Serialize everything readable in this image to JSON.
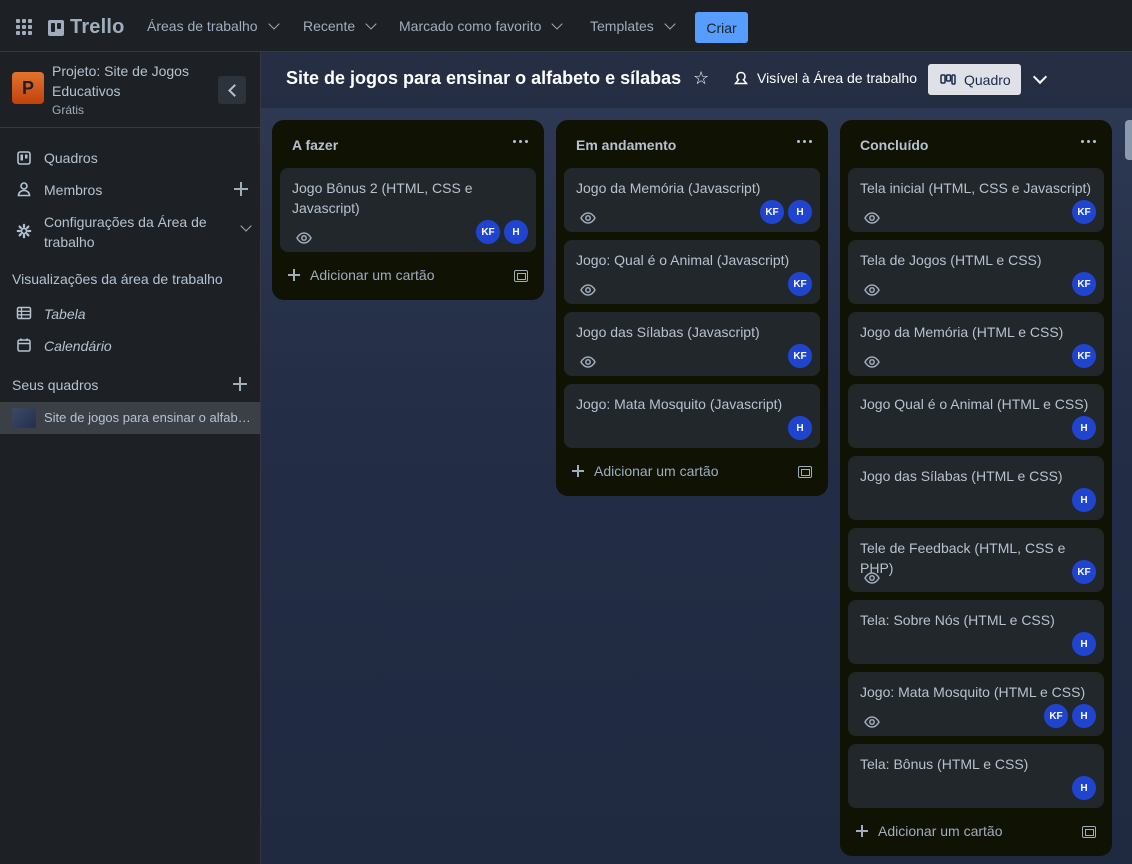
{
  "nav": {
    "logo": "Trello",
    "menus": [
      "Áreas de trabalho",
      "Recente",
      "Marcado como favorito",
      "Templates"
    ],
    "create_label": "Criar"
  },
  "sidebar": {
    "workspace_name": "Projeto:  Site de Jogos Educativos",
    "workspace_initial": "P",
    "workspace_plan": "Grátis",
    "items": [
      {
        "label": "Quadros",
        "icon": "board-icon"
      },
      {
        "label": "Membros",
        "icon": "member-icon"
      },
      {
        "label": "Configurações da Área de trabalho",
        "icon": "gear-icon"
      }
    ],
    "views_heading": "Visualizações da área de trabalho",
    "views": [
      {
        "label": "Tabela",
        "icon": "table-icon"
      },
      {
        "label": "Calendário",
        "icon": "calendar-icon"
      }
    ],
    "boards_heading": "Seus quadros",
    "boards": [
      "Site de jogos para ensinar o alfabeto e sílabas"
    ]
  },
  "board": {
    "title": "Site de jogos para ensinar o alfabeto e sílabas",
    "visibility": "Visível à Área de trabalho",
    "view_label": "Quadro",
    "add_card_label": "Adicionar um cartão",
    "lists": [
      {
        "title": "A fazer",
        "cards": [
          {
            "text": "Jogo Bônus 2 (HTML, CSS e Javascript)",
            "watch": true,
            "members": [
              "KF",
              "H"
            ]
          }
        ]
      },
      {
        "title": "Em andamento",
        "cards": [
          {
            "text": "Jogo da Memória (Javascript)",
            "watch": true,
            "members": [
              "KF",
              "H"
            ]
          },
          {
            "text": "Jogo: Qual é o Animal (Javascript)",
            "watch": true,
            "members": [
              "KF"
            ]
          },
          {
            "text": "Jogo das Sílabas (Javascript)",
            "watch": true,
            "members": [
              "KF"
            ]
          },
          {
            "text": "Jogo: Mata Mosquito (Javascript)",
            "watch": false,
            "members": [
              "H"
            ]
          }
        ]
      },
      {
        "title": "Concluído",
        "cards": [
          {
            "text": "Tela inicial (HTML, CSS e Javascript)",
            "watch": true,
            "members": [
              "KF"
            ]
          },
          {
            "text": "Tela de Jogos (HTML e CSS)",
            "watch": true,
            "members": [
              "KF"
            ]
          },
          {
            "text": "Jogo da Memória (HTML e CSS)",
            "watch": true,
            "members": [
              "KF"
            ]
          },
          {
            "text": "Jogo Qual é o Animal (HTML e CSS)",
            "watch": false,
            "members": [
              "H"
            ]
          },
          {
            "text": "Jogo das Sílabas (HTML e CSS)",
            "watch": false,
            "members": [
              "H"
            ]
          },
          {
            "text": "Tele de Feedback (HTML, CSS e PHP)",
            "watch": true,
            "members": [
              "KF"
            ]
          },
          {
            "text": "Tela: Sobre Nós (HTML e CSS)",
            "watch": false,
            "members": [
              "H"
            ]
          },
          {
            "text": "Jogo: Mata Mosquito (HTML e CSS)",
            "watch": true,
            "members": [
              "KF",
              "H"
            ]
          },
          {
            "text": "Tela: Bônus (HTML e CSS)",
            "watch": false,
            "members": [
              "H"
            ]
          }
        ]
      }
    ]
  }
}
